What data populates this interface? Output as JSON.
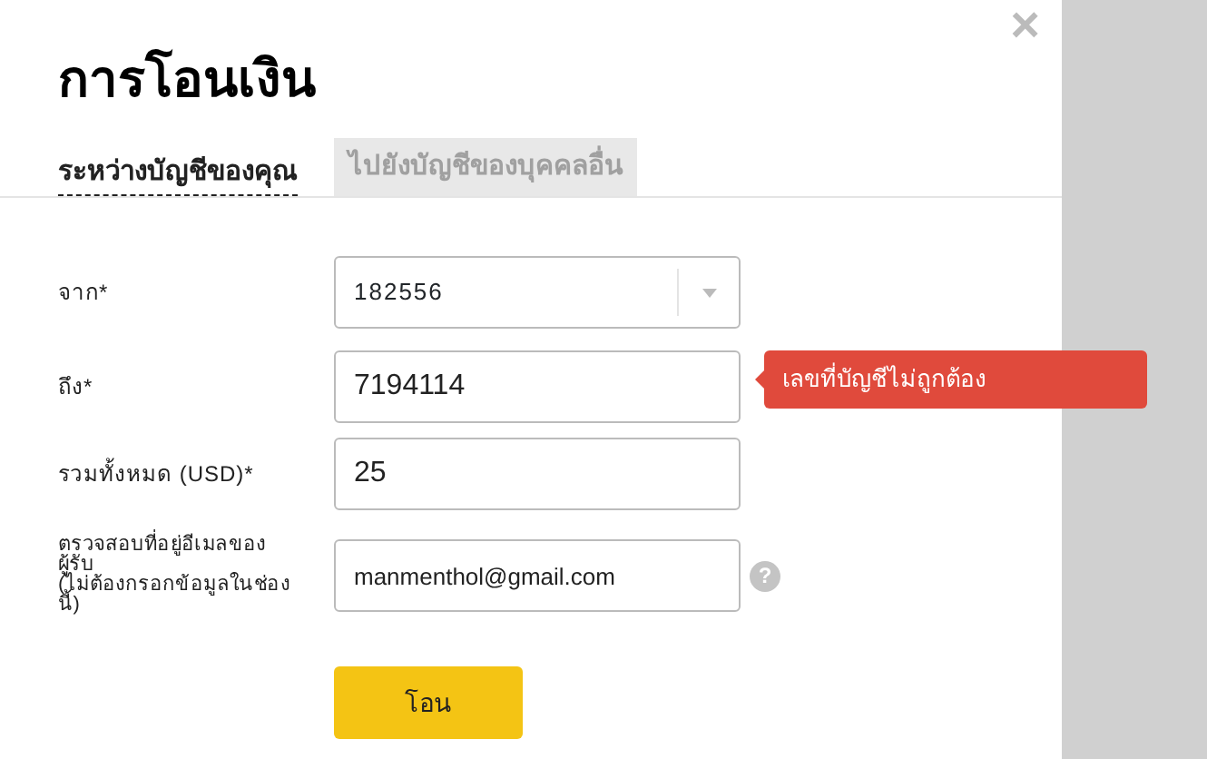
{
  "dialog": {
    "title": "การโอนเงิน",
    "close": "×"
  },
  "tabs": [
    {
      "label": "ระหว่างบัญชีของคุณ",
      "selected": true
    },
    {
      "label": "ไปยังบัญชีของบุคคลอื่น",
      "selected": false
    }
  ],
  "fields": [
    {
      "kind": "select",
      "label": "จาก*",
      "value": "182556"
    },
    {
      "kind": "text",
      "label": "ถึง*",
      "value": "7194114",
      "error": "เลขที่บัญชีไม่ถูกต้อง"
    },
    {
      "kind": "text",
      "label": "รวมทั้งหมด (USD)*",
      "value": "25"
    },
    {
      "kind": "email",
      "label": "ตรวจสอบที่อยู่อีเมลของผู้รับ",
      "note": "(ไม่ต้องกรอกข้อมูลในช่องนี้)",
      "value": "manmenthol@gmail.com",
      "help": "?"
    }
  ],
  "submit": "โอน"
}
